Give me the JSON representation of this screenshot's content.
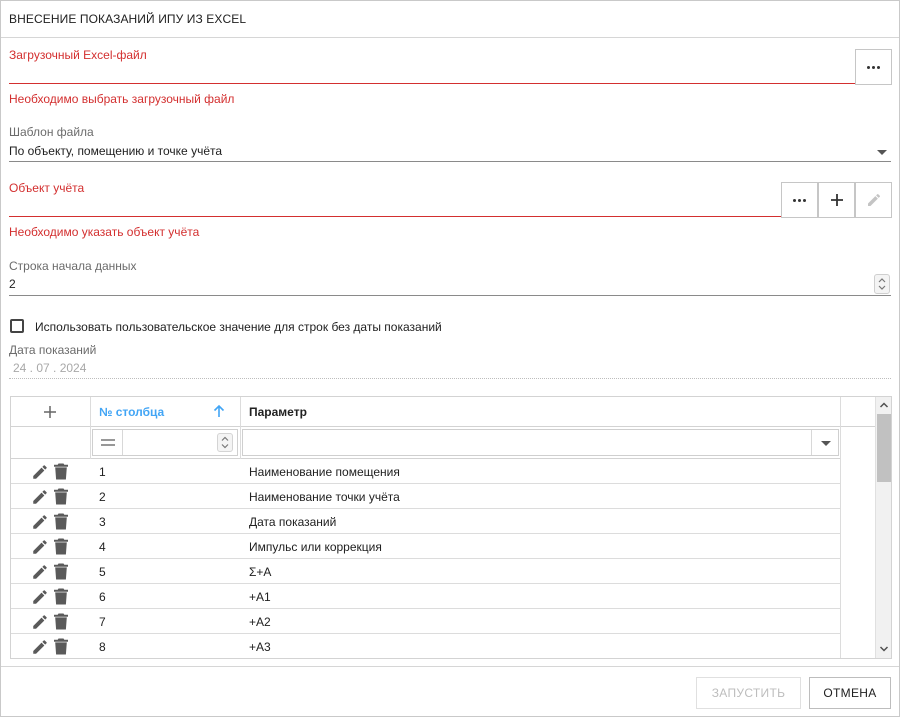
{
  "dialog": {
    "title": "ВНЕСЕНИЕ ПОКАЗАНИЙ ИПУ ИЗ EXCEL"
  },
  "file_field": {
    "label": "Загрузочный Excel-файл",
    "error": "Необходимо выбрать загрузочный файл",
    "browse_icon": "ellipsis-icon"
  },
  "template_field": {
    "label": "Шаблон файла",
    "value": "По объекту, помещению и точке учёта"
  },
  "account_object_field": {
    "label": "Объект учёта",
    "error": "Необходимо указать объект учёта"
  },
  "start_row_field": {
    "label": "Строка начала данных",
    "value": "2"
  },
  "custom_value_checkbox": {
    "label": "Использовать пользовательское значение для строк без даты показаний",
    "checked": false
  },
  "reading_date_field": {
    "label": "Дата показаний",
    "value": "24 . 07 . 2024"
  },
  "grid": {
    "columns": {
      "number": "№ столбца",
      "parameter": "Параметр"
    },
    "rows": [
      {
        "num": "1",
        "param": "Наименование помещения"
      },
      {
        "num": "2",
        "param": "Наименование точки учёта"
      },
      {
        "num": "3",
        "param": "Дата показаний"
      },
      {
        "num": "4",
        "param": "Импульс или коррекция"
      },
      {
        "num": "5",
        "param": "Σ+A"
      },
      {
        "num": "6",
        "param": "+A1"
      },
      {
        "num": "7",
        "param": "+A2"
      },
      {
        "num": "8",
        "param": "+A3"
      }
    ]
  },
  "footer": {
    "run_label": "ЗАПУСТИТЬ",
    "cancel_label": "ОТМЕНА"
  },
  "colors": {
    "error": "#d32f2f",
    "accent": "#42a5f5",
    "label": "#6b6b6b"
  }
}
